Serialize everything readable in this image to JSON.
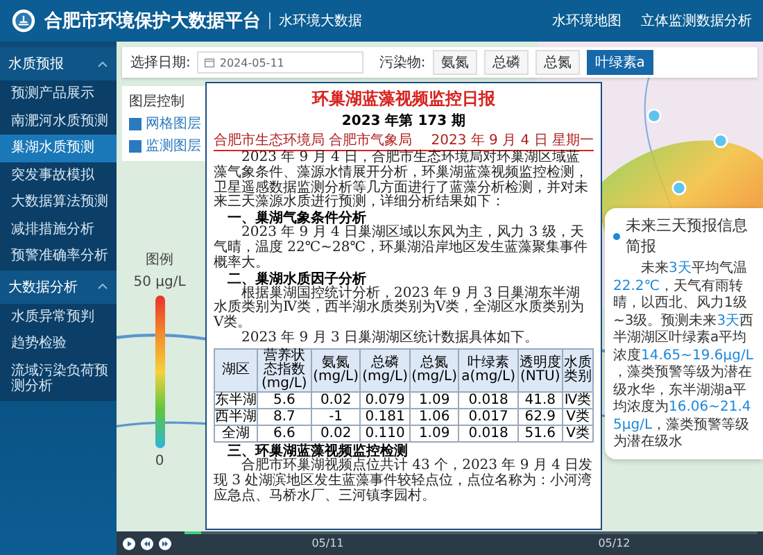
{
  "header": {
    "title": "合肥市环境保护大数据平台",
    "subtitle": "水环境大数据",
    "nav": [
      "水环境地图",
      "立体监测数据分析"
    ]
  },
  "sidebar": {
    "groups": [
      {
        "label": "水质预报",
        "expanded": true,
        "children": [
          {
            "label": "预测产品展示",
            "selected": false
          },
          {
            "label": "南淝河水质预测",
            "selected": false
          },
          {
            "label": "巢湖水质预测",
            "selected": true
          },
          {
            "label": "突发事故模拟",
            "selected": false
          },
          {
            "label": "大数据算法预测",
            "selected": false
          },
          {
            "label": "减排措施分析",
            "selected": false
          },
          {
            "label": "预警准确率分析",
            "selected": false
          }
        ]
      },
      {
        "label": "大数据分析",
        "expanded": true,
        "children": [
          {
            "label": "水质异常预判",
            "selected": false
          },
          {
            "label": "趋势检验",
            "selected": false
          },
          {
            "label": "流域污染负荷预测分析",
            "selected": false
          }
        ]
      }
    ]
  },
  "toolbar": {
    "date_label": "选择日期:",
    "date_value": "2024-05-11",
    "pollutant_label": "污染物:",
    "pollutants": [
      {
        "label": "氨氮",
        "selected": false
      },
      {
        "label": "总磷",
        "selected": false
      },
      {
        "label": "总氮",
        "selected": false
      },
      {
        "label": "叶绿素a",
        "selected": true
      }
    ]
  },
  "layer_control": {
    "title": "图层控制",
    "layers": [
      {
        "label": "网格图层",
        "checked": true
      },
      {
        "label": "监测图层",
        "checked": true
      }
    ]
  },
  "legend": {
    "title": "图例",
    "max": "50 μg/L",
    "min": "0"
  },
  "report": {
    "title": "环巢湖蓝藻视频监控日报",
    "issue": "2023 年第 173 期",
    "agency": "合肥市生态环境局  合肥市气象局",
    "date": "2023 年 9 月 4 日  星期一",
    "blocks": [
      {
        "kind": "para",
        "text": "2023 年 9 月 4 日，合肥市生态环境局对环巢湖区域蓝藻气象条件、藻源水情展开分析，环巢湖蓝藻视频监控检测，卫星遥感数据监测分析等几方面进行了蓝藻分析检测，并对未来三天藻源水质进行预测，详细分析结果如下："
      },
      {
        "kind": "heading",
        "text": "一、巢湖气象条件分析"
      },
      {
        "kind": "para",
        "text": "2023 年 9 月 4 日巢湖区域以东风为主，风力 3 级，天气晴，温度 22℃~28℃，环巢湖沿岸地区发生蓝藻聚集事件概率大。"
      },
      {
        "kind": "heading",
        "text": "二、巢湖水质因子分析"
      },
      {
        "kind": "para",
        "text": "根据巢湖国控统计分析，2023 年 9 月 3 日巢湖东半湖水质类别为Ⅳ类，西半湖水质类别为Ⅴ类，全湖区水质类别为Ⅴ类。"
      },
      {
        "kind": "para",
        "text": "2023 年 9 月 3 日巢湖湖区统计数据具体如下。"
      },
      {
        "kind": "table",
        "columns": [
          "湖区",
          "营养状态指数(mg/L)",
          "氨氮(mg/L)",
          "总磷(mg/L)",
          "总氮(mg/L)",
          "叶绿素a(mg/L)",
          "透明度(NTU)",
          "水质类别"
        ],
        "rows": [
          [
            "东半湖",
            "5.6",
            "0.02",
            "0.079",
            "1.09",
            "0.018",
            "41.8",
            "Ⅳ类"
          ],
          [
            "西半湖",
            "8.7",
            "-1",
            "0.181",
            "1.06",
            "0.017",
            "62.9",
            "Ⅴ类"
          ],
          [
            "全湖",
            "6.6",
            "0.02",
            "0.110",
            "1.09",
            "0.018",
            "51.6",
            "Ⅴ类"
          ]
        ]
      },
      {
        "kind": "heading",
        "text": "三、环巢湖蓝藻视频监控检测"
      },
      {
        "kind": "para",
        "text": "合肥市环巢湖视频点位共计 43 个，2023 年 9 月 4 日发现 3 处湖滨地区发生蓝藻事件较轻点位，点位名称为：小河湾应急点、马桥水厂、三河镇李园村。"
      }
    ]
  },
  "forecast_card": {
    "title": "未来三天预报信息简报",
    "segments": [
      {
        "text": "未来",
        "highlight": false
      },
      {
        "text": "3天",
        "highlight": true
      },
      {
        "text": "平均气温",
        "highlight": false
      },
      {
        "text": "22.2℃",
        "highlight": true
      },
      {
        "text": "，天气有雨转晴，以西北、风力1级~3级。预测未来",
        "highlight": false
      },
      {
        "text": "3天",
        "highlight": true
      },
      {
        "text": "西半湖湖区叶绿素a平均浓度",
        "highlight": false
      },
      {
        "text": "14.65~19.6μg/L",
        "highlight": true
      },
      {
        "text": "，藻类预警等级为潜在级水华，东半湖湖a平均浓度为",
        "highlight": false
      },
      {
        "text": "16.06~21.45μg/L",
        "highlight": true
      },
      {
        "text": "，藻类预警等级为潜在级水",
        "highlight": false
      }
    ]
  },
  "timeline": {
    "level": 0.03,
    "dates": [
      "05/11",
      "05/12"
    ]
  }
}
